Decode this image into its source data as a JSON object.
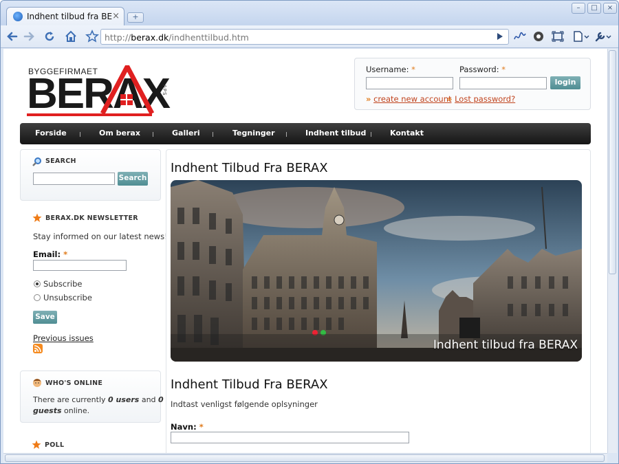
{
  "browser": {
    "tab_title": "Indhent tilbud fra BE...",
    "tab_close": "×",
    "newtab": "+",
    "url_prefix": "http://",
    "url_host": "berax.dk",
    "url_path": "/indhenttilbud.htm",
    "win_min": "–",
    "win_max": "□",
    "win_close": "×"
  },
  "logo": {
    "top_text": "BYGGEFIRMAET",
    "main_text": "BERAX",
    "side_text": "APS"
  },
  "login": {
    "username_label": "Username:",
    "password_label": "Password:",
    "required": "*",
    "button": "login",
    "links_prefix": "»",
    "create_account": "create new account",
    "lost_password": "Lost password?"
  },
  "nav": {
    "items": [
      "Forside",
      "Om berax",
      "Galleri",
      "Tegninger",
      "Indhent tilbud",
      "Kontakt"
    ],
    "sep": "|"
  },
  "search_block": {
    "title": "SEARCH",
    "button": "Search"
  },
  "newsletter": {
    "title": "BERAX.DK NEWSLETTER",
    "intro": "Stay informed on our latest news!",
    "email_label": "Email:",
    "required": "*",
    "subscribe": "Subscribe",
    "unsubscribe": "Unsubscribe",
    "selected": "Subscribe",
    "save": "Save",
    "previous": "Previous issues"
  },
  "whos_online": {
    "title": "WHO'S ONLINE",
    "line1_a": "There are currently ",
    "users": "0 users",
    "line1_b": " and ",
    "guests_num": "0",
    "guests_word": "guests",
    "line2_b": " online."
  },
  "poll": {
    "title": "POLL"
  },
  "main": {
    "title": "Indhent Tilbud Fra BERAX",
    "hero_caption": "Indhent tilbud fra BERAX",
    "subtitle": "Indhent Tilbud Fra BERAX",
    "intro": "Indtast venligst følgende oplsyninger",
    "navn_label": "Navn:",
    "required": "*"
  },
  "colors": {
    "accent_teal": "#5a969c",
    "link_red": "#c0431d",
    "required_orange": "#e07b1c",
    "nav_dark": "#1f1f1f"
  }
}
